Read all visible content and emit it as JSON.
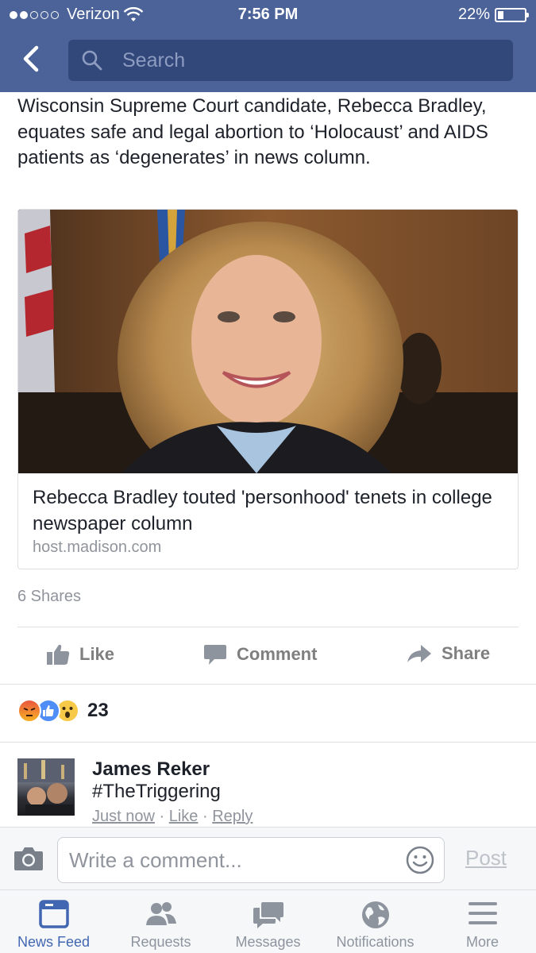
{
  "status_bar": {
    "carrier": "Verizon",
    "time": "7:56 PM",
    "battery": "22%",
    "battery_level": 0.22
  },
  "nav": {
    "search_placeholder": "Search"
  },
  "post": {
    "text": "Wisconsin Supreme Court candidate, Rebecca Bradley, equates safe and legal abortion to ‘Holocaust’ and AIDS patients as ‘degenerates’ in news column.",
    "link": {
      "title": "Rebecca Bradley touted 'personhood' tenets in college newspaper column",
      "domain": "host.madison.com"
    },
    "shares": "6 Shares",
    "actions": {
      "like": "Like",
      "comment": "Comment",
      "share": "Share"
    },
    "reactions": {
      "count": "23",
      "types": [
        "angry",
        "like",
        "wow"
      ]
    }
  },
  "comment": {
    "author": "James Reker",
    "text": "#TheTriggering",
    "time": "Just now",
    "like": "Like",
    "reply": "Reply",
    "separator": "·"
  },
  "composer": {
    "placeholder": "Write a comment...",
    "post_label": "Post"
  },
  "tabs": [
    {
      "label": "News Feed",
      "icon": "news-feed-icon",
      "active": true
    },
    {
      "label": "Requests",
      "icon": "requests-icon",
      "active": false
    },
    {
      "label": "Messages",
      "icon": "messages-icon",
      "active": false
    },
    {
      "label": "Notifications",
      "icon": "globe-icon",
      "active": false
    },
    {
      "label": "More",
      "icon": "menu-icon",
      "active": false
    }
  ],
  "colors": {
    "brand": "#4b6399",
    "active_tab": "#4267b2"
  }
}
